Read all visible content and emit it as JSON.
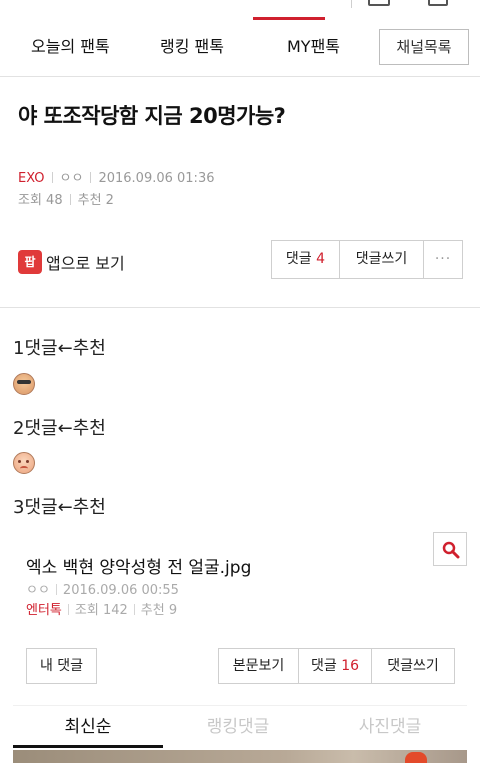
{
  "nav": {
    "tabs": [
      "오늘의 팬톡",
      "랭킹 팬톡",
      "MY팬톡"
    ],
    "channel_button": "채널목록"
  },
  "post": {
    "title": "야 또조작당함 지금 20명가능?",
    "category": "EXO",
    "author": "ㅇㅇ",
    "datetime": "2016.09.06 01:36",
    "views": "조회 48",
    "recommend": "추천 2"
  },
  "actions": {
    "app_view": "앱으로 보기",
    "app_icon": "팝",
    "comments_label": "댓글",
    "comments_count": "4",
    "write_comment": "댓글쓰기",
    "more": "···"
  },
  "content": {
    "line1": "1댓글←추천",
    "line2": "2댓글←추천",
    "line3": "3댓글←추천"
  },
  "related": {
    "title": "엑소 백현 양악성형 전 얼굴.jpg",
    "author": "ㅇㅇ",
    "datetime": "2016.09.06 00:55",
    "category": "엔터톡",
    "views": "조회 142",
    "recommend": "추천 9"
  },
  "bottom_actions": {
    "my_comments": "내 댓글",
    "view_body": "본문보기",
    "comments_label": "댓글",
    "comments_count": "16",
    "write_comment": "댓글쓰기"
  },
  "comment_tabs": [
    "최신순",
    "랭킹댓글",
    "사진댓글"
  ],
  "colors": {
    "accent": "#d0202e"
  }
}
